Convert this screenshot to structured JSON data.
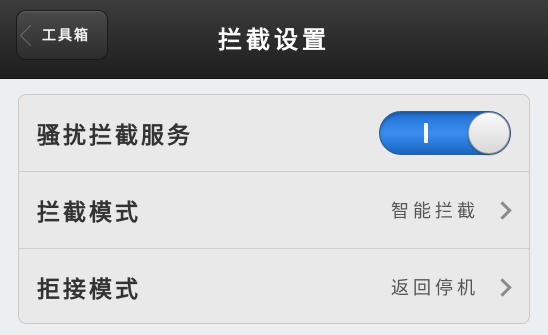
{
  "navbar": {
    "back_label": "工具箱",
    "title": "拦截设置"
  },
  "settings": {
    "rows": [
      {
        "label": "骚扰拦截服务",
        "toggle_on": true
      },
      {
        "label": "拦截模式",
        "value": "智能拦截"
      },
      {
        "label": "拒接模式",
        "value": "返回停机"
      }
    ]
  },
  "colors": {
    "toggle_on": "#2a7de6",
    "navbar": "#2b2b2b"
  }
}
